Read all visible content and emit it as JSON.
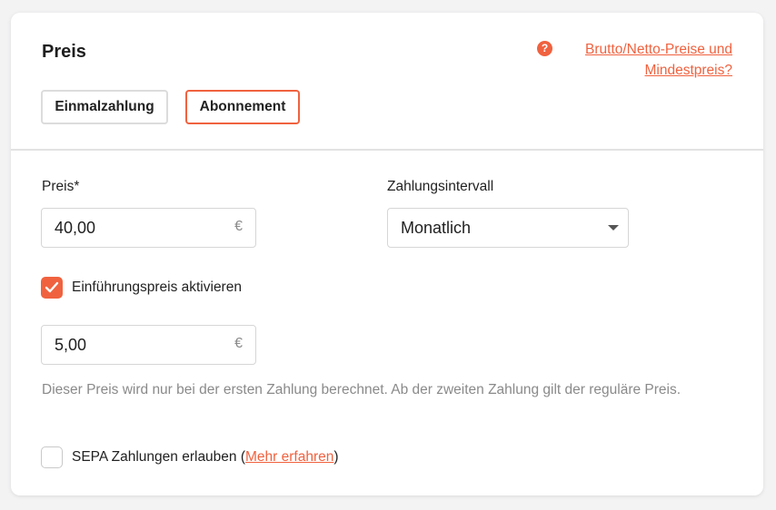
{
  "section": {
    "title": "Preis",
    "help_link": "Brutto/Netto-Preise und Mindestpreis?",
    "help_icon": "question-icon"
  },
  "tabs": [
    {
      "label": "Einmalzahlung",
      "selected": false
    },
    {
      "label": "Abonnement",
      "selected": true
    }
  ],
  "price": {
    "label": "Preis*",
    "value": "40,00",
    "currency": "€"
  },
  "interval": {
    "label": "Zahlungsintervall",
    "selected": "Monatlich"
  },
  "intro_price": {
    "checkbox_label": "Einführungspreis aktivieren",
    "checked": true,
    "value": "5,00",
    "currency": "€",
    "hint": "Dieser Preis wird nur bei der ersten Zahlung berechnet. Ab der zweiten Zahlung gilt der reguläre Preis."
  },
  "sepa": {
    "label_prefix": "SEPA Zahlungen erlauben (",
    "link": "Mehr erfahren",
    "label_suffix": ")",
    "checked": false
  },
  "colors": {
    "accent": "#f0623f",
    "border": "#d6d6d6",
    "muted_text": "#8a8a8a"
  }
}
